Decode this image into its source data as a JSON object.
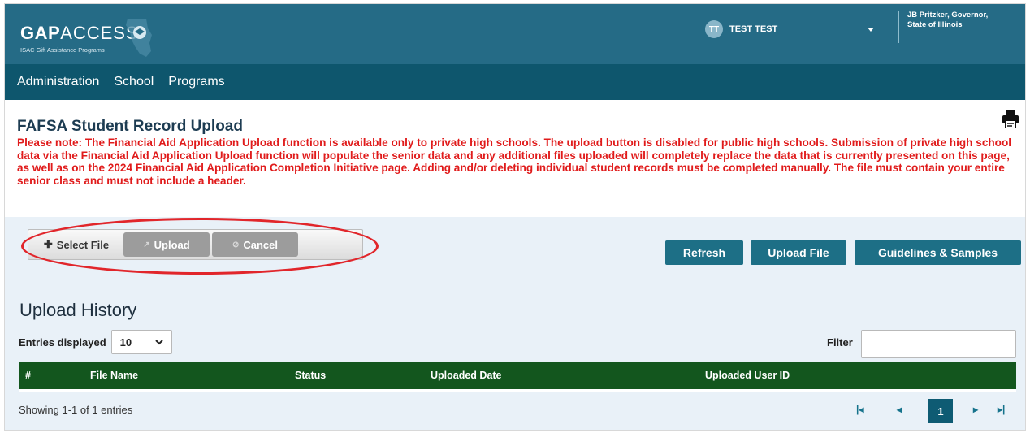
{
  "header": {
    "logo_brand": "GAP",
    "logo_access": "ACCESS",
    "logo_subtitle": "ISAC Gift Assistance Programs",
    "user_initials": "TT",
    "user_name": "TEST TEST",
    "governor_line1": "JB Pritzker, Governor,",
    "governor_line2": "State of Illinois"
  },
  "nav": {
    "items": [
      "Administration",
      "School",
      "Programs"
    ]
  },
  "notice": {
    "title": "FAFSA Student Record Upload",
    "warning": "Please note: The Financial Aid Application Upload function is available only to private high schools. The upload button is disabled for public high schools. Submission of private high school data via the Financial Aid Application Upload function will populate the senior data and any additional files uploaded will completely replace the data that is currently presented on this page, as well as on the 2024 Financial Aid Application Completion Initiative page. Adding and/or deleting individual student records must be completed manually. The file must contain your entire senior class and must not include a header."
  },
  "upload_controls": {
    "select_label": "Select File",
    "upload_label": "Upload",
    "cancel_label": "Cancel"
  },
  "actions": {
    "refresh": "Refresh",
    "upload_file": "Upload File",
    "guidelines": "Guidelines & Samples"
  },
  "history": {
    "title": "Upload History",
    "entries_label": "Entries displayed",
    "entries_value": "10",
    "filter_label": "Filter",
    "filter_value": "",
    "columns": [
      "#",
      "File Name",
      "Status",
      "Uploaded Date",
      "Uploaded User ID"
    ],
    "showing": "Showing 1-1 of 1 entries",
    "current_page": "1"
  },
  "colors": {
    "topbar": "#256b86",
    "navbar": "#0e566d",
    "warning_red": "#e01b1b",
    "action_button": "#1d6f86",
    "table_header": "#13561e",
    "highlight_ring": "#e1262b"
  }
}
